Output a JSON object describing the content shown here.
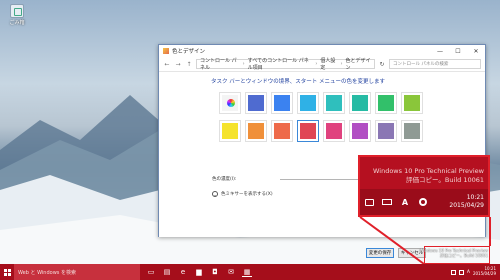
{
  "desktop": {
    "icon_label": "ごみ箱"
  },
  "window": {
    "title": "色とデザイン",
    "controls": {
      "minimize": "—",
      "maximize": "☐",
      "close": "✕"
    },
    "breadcrumbs": [
      "コントロール パネル",
      "すべてのコントロール パネル項目",
      "個人設定",
      "色とデザイン"
    ],
    "search_placeholder": "コントロール パネルの検索",
    "heading": "タスク バーとウィンドウの境界、スタート メニューの色を変更します",
    "swatches": [
      {
        "color": "auto"
      },
      {
        "color": "#4f6bd0"
      },
      {
        "color": "#3b82f0"
      },
      {
        "color": "#2fb1e6"
      },
      {
        "color": "#2fbfbd"
      },
      {
        "color": "#26bba4"
      },
      {
        "color": "#32c06a"
      },
      {
        "color": "#8ac63a"
      },
      {
        "color": "#f5e32c"
      },
      {
        "color": "#f0903a"
      },
      {
        "color": "#ee6a4a"
      },
      {
        "color": "#e04655"
      },
      {
        "color": "#e0427e"
      },
      {
        "color": "#b14fc3"
      },
      {
        "color": "#8a77b4"
      },
      {
        "color": "#8f9a94"
      }
    ],
    "selected_index": 11,
    "intensity_label": "色の濃度(I):",
    "intensity_value": 0.9,
    "mixer_label": "色ミキサーを表示する(X)",
    "save_label": "変更の保存",
    "cancel_label": "キャンセル"
  },
  "callout": {
    "watermark_line1": "Windows 10 Pro Technical Preview",
    "watermark_line2": "評価コピー。Build 10061",
    "time": "10:21",
    "date": "2015/04/29",
    "ime_label": "A"
  },
  "small_watermark": {
    "line1": "Windows 10 Pro Technical Preview",
    "line2": "評価コピー。Build 10061"
  },
  "taskbar": {
    "search_placeholder": "Web と Windows を検索",
    "time": "10:21",
    "date": "2015/04/29",
    "ime_label": "A"
  },
  "colors": {
    "accent": "#a50e1b",
    "callout_border": "#e0202a"
  }
}
